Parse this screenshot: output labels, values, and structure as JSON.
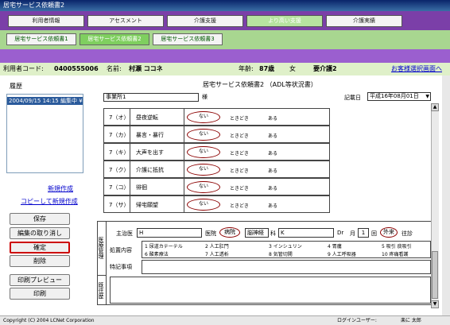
{
  "window": {
    "title": "居宅サービス依頼書2"
  },
  "nav_tabs": [
    {
      "label": "利用者情報"
    },
    {
      "label": "アセスメント"
    },
    {
      "label": "介護支援"
    },
    {
      "label": "より高い支援"
    },
    {
      "label": "介護実績"
    }
  ],
  "sub_tabs": [
    {
      "label": "居宅サービス依頼書1"
    },
    {
      "label": "居宅サービス依頼書2"
    },
    {
      "label": "居宅サービス依頼書3"
    }
  ],
  "user_info": {
    "code_label": "利用者コード:",
    "code": "0400555006",
    "name_label": "名前:",
    "name": "村瀬 ココネ",
    "age_label": "年齢:",
    "age": "87歳",
    "sex": "女",
    "care_level": "要介護2",
    "customer_select_link": "お客様選択画面へ"
  },
  "history": {
    "label": "履歴",
    "selected_item": "2004/09/15 14:15 編集中 ¥",
    "new_link": "新規作成",
    "copy_new_link": "コピーして新規作成"
  },
  "buttons": {
    "save": "保存",
    "cancel_edit": "編集の取り消し",
    "confirm": "確定",
    "delete": "削除",
    "print_preview": "印刷プレビュー",
    "print": "印刷"
  },
  "document": {
    "title": "居宅サービス依頼書2 （ADL等状況書）",
    "office": "事業所1",
    "sama": "様",
    "date_label": "記載日",
    "date": "平成16年08月01日"
  },
  "adl_rows": [
    {
      "id": "7（オ）",
      "name": "昼夜逆転",
      "selected": "ない",
      "opt2": "ときどき",
      "opt3": "ある"
    },
    {
      "id": "7（カ）",
      "name": "暴言・暴行",
      "selected": "ない",
      "opt2": "ときどき",
      "opt3": "ある"
    },
    {
      "id": "7（キ）",
      "name": "大声を出す",
      "selected": "ない",
      "opt2": "ときどき",
      "opt3": "ある"
    },
    {
      "id": "7（ク）",
      "name": "介護に抵抗",
      "selected": "ない",
      "opt2": "ときどき",
      "opt3": "ある"
    },
    {
      "id": "7（コ）",
      "name": "徘徊",
      "selected": "ない",
      "opt2": "ときどき",
      "opt3": "ある"
    },
    {
      "id": "7（サ）",
      "name": "帰宅願望",
      "selected": "ない",
      "opt2": "ときどき",
      "opt3": "ある"
    }
  ],
  "medical": {
    "side_label": "医療管理",
    "doctor_label": "主治医",
    "doctor_value": "H",
    "clinic_label": "医院",
    "clinic_selected": "病院",
    "dept_value": "脳神経",
    "dept_label": "科",
    "doctor_name": "K",
    "dr_label": "Dr",
    "freq_label": "月",
    "freq_value": "1",
    "freq_unit": "回",
    "visit_selected": "外来",
    "home_label": "往診",
    "treatment_label": "処置内容",
    "treatments_row1": [
      "1 尿道カテーテル",
      "2 人工肛門",
      "3 インシュリン",
      "4 胃瘻",
      "5 吸引 痰吸引"
    ],
    "treatments_row2": [
      "6 酸素療法",
      "7 人工透析",
      "8 気管切開",
      "9 人工呼吸器",
      "10 疼痛看護"
    ],
    "notes_label": "特記事項",
    "history_side_label": "既往歴"
  },
  "status": {
    "copyright": "Copyright (C) 2004 LCNet Corporation",
    "login_label": "ログインユーザー:",
    "login_user": "楽に 太郎"
  }
}
